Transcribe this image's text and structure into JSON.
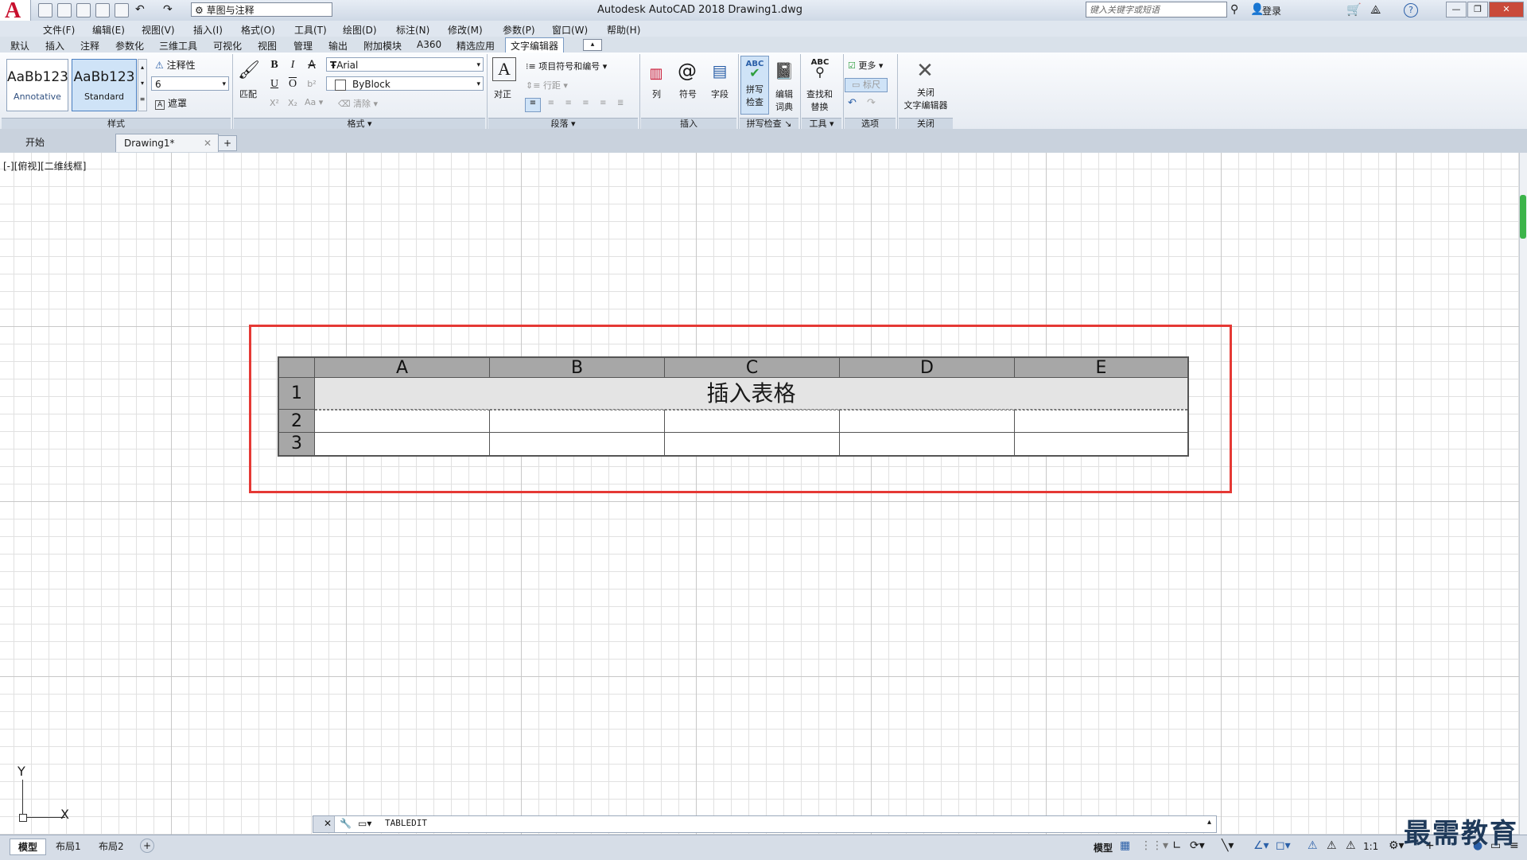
{
  "title_bar": {
    "app_logo": "A",
    "workspace": "草图与注释",
    "window_title": "Autodesk AutoCAD 2018    Drawing1.dwg",
    "search_placeholder": "键入关键字或短语",
    "login": "登录",
    "help": "?"
  },
  "menu": [
    "文件(F)",
    "编辑(E)",
    "视图(V)",
    "插入(I)",
    "格式(O)",
    "工具(T)",
    "绘图(D)",
    "标注(N)",
    "修改(M)",
    "参数(P)",
    "窗口(W)",
    "帮助(H)"
  ],
  "ribbon_tabs": [
    "默认",
    "插入",
    "注释",
    "参数化",
    "三维工具",
    "可视化",
    "视图",
    "管理",
    "输出",
    "附加模块",
    "A360",
    "精选应用",
    "文字编辑器"
  ],
  "active_tab": "文字编辑器",
  "ribbon": {
    "style": {
      "title": "样式",
      "style1_preview": "AaBb123",
      "style1_name": "Annotative",
      "style2_preview": "AaBb123",
      "style2_name": "Standard",
      "annotative_label": "注释性",
      "height_value": "6",
      "mask_label": "遮罩"
    },
    "format": {
      "title": "格式",
      "match_label": "匹配",
      "bold": "B",
      "italic": "I",
      "strike": "A",
      "underline": "U",
      "overline": "O",
      "font_value": "Arial",
      "color_value": "ByBlock",
      "clear_label": "清除",
      "case_label": "Aa"
    },
    "paragraph": {
      "title": "段落",
      "justify_label": "对正",
      "bullets_label": "项目符号和编号",
      "line_spacing_label": "行距"
    },
    "insert": {
      "title": "插入",
      "columns_label": "列",
      "symbol_label": "符号",
      "field_label": "字段"
    },
    "spell": {
      "title": "拼写检查",
      "spell_check_line1": "拼写",
      "spell_check_line2": "检查",
      "edit_dict_line1": "编辑",
      "edit_dict_line2": "词典",
      "spell_icon_text": "ABC"
    },
    "tools": {
      "title": "工具",
      "find_line1": "查找和",
      "find_line2": "替换",
      "find_icon_text": "ABC"
    },
    "options": {
      "title": "选项",
      "more_label": "更多",
      "ruler_label": "标尺"
    },
    "close": {
      "title": "关闭",
      "close_line1": "关闭",
      "close_line2": "文字编辑器"
    }
  },
  "doc_tabs": {
    "start": "开始",
    "drawing": "Drawing1*",
    "add": "+"
  },
  "viewport_label": "[-][俯视][二维线框]",
  "table": {
    "columns": [
      "A",
      "B",
      "C",
      "D",
      "E"
    ],
    "rows": [
      "1",
      "2",
      "3"
    ],
    "title_text": "插入表格"
  },
  "ucs": {
    "x_label": "X",
    "y_label": "Y"
  },
  "command_line": {
    "text": "TABLEDIT"
  },
  "layout_tabs": [
    "模型",
    "布局1",
    "布局2"
  ],
  "layout_add": "+",
  "status": {
    "model_label": "模型",
    "scale": "1:1"
  },
  "watermark": "最需教育"
}
